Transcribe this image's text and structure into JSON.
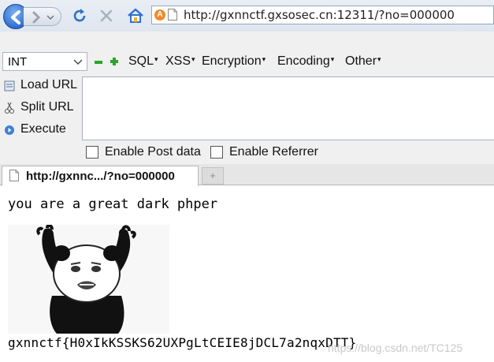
{
  "browser": {
    "url": "http://gxnnctf.gxsosec.cn:12311/?no=000000",
    "site_badge": "A"
  },
  "hackbar": {
    "type_select": "INT",
    "menus": [
      "SQL",
      "XSS",
      "Encryption",
      "Encoding",
      "Other"
    ],
    "side_buttons": [
      "Load URL",
      "Split URL",
      "Execute"
    ],
    "textarea_value": "",
    "checkboxes": [
      {
        "label": "Enable Post data",
        "checked": false
      },
      {
        "label": "Enable Referrer",
        "checked": false
      }
    ]
  },
  "tabs": {
    "active_title": "http://gxnnc.../?no=000000",
    "new_tab_symbol": "+"
  },
  "page": {
    "message": "you are a great dark phper",
    "flag": "gxnnctf{H0xIkKSSKS62UXPgLtCEIE8jDCL7a2nqxDTT}",
    "watermark": "https://blog.csdn.net/TC125"
  },
  "colors": {
    "nav_accent": "#2f6fd0",
    "hackbar_bg": "#f0f0f0",
    "plus_green": "#2aa52a",
    "site_badge": "#f08a2a"
  }
}
